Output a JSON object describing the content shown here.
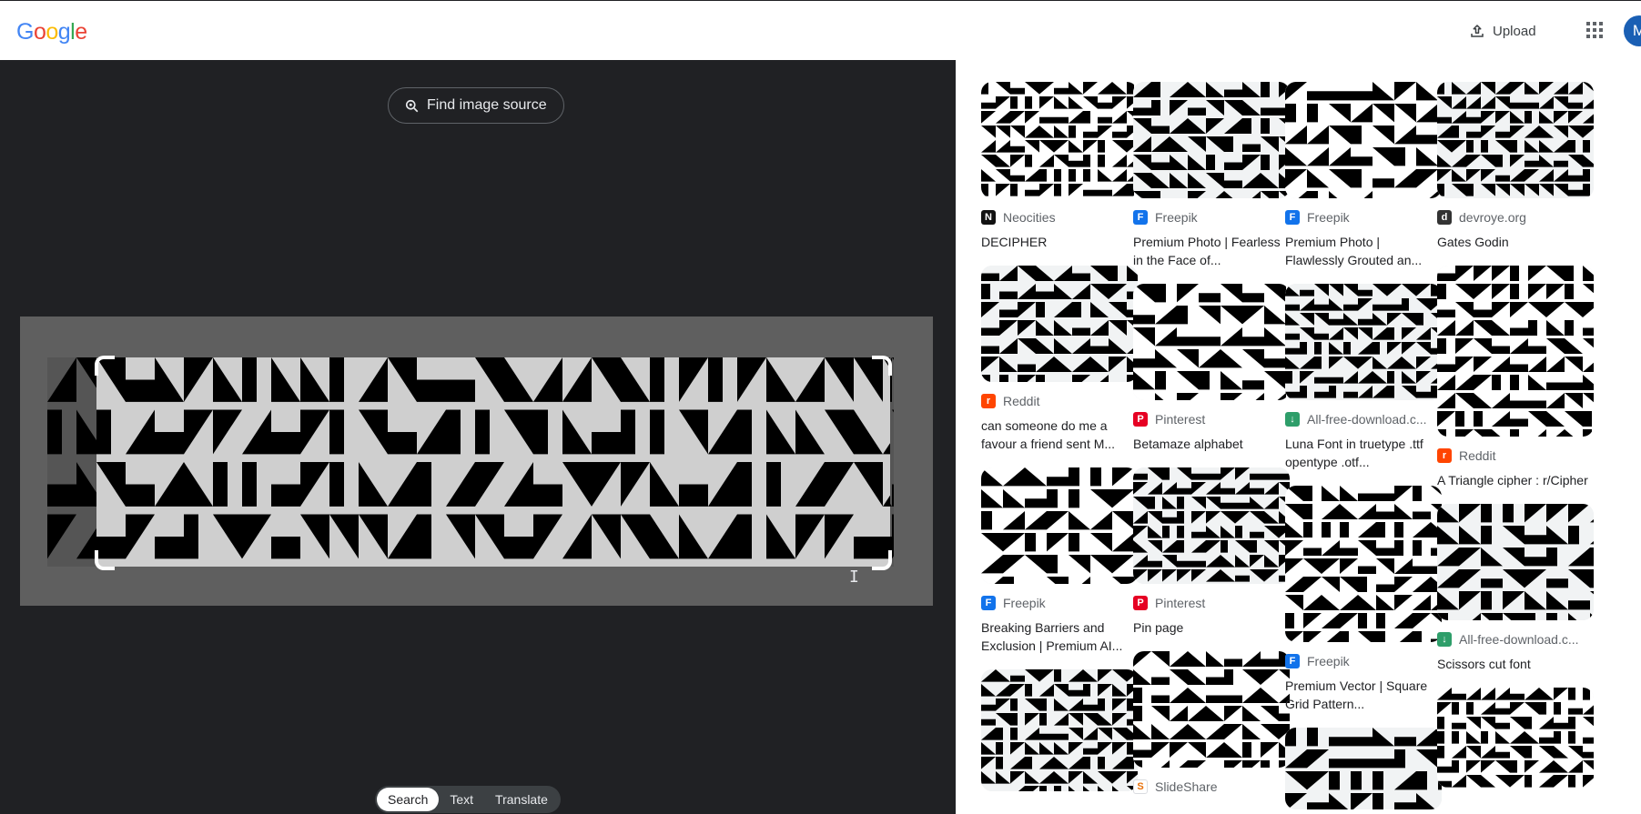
{
  "header": {
    "logo_letters": [
      {
        "ch": "G",
        "color": "#4285F4"
      },
      {
        "ch": "o",
        "color": "#EA4335"
      },
      {
        "ch": "o",
        "color": "#FBBC05"
      },
      {
        "ch": "g",
        "color": "#4285F4"
      },
      {
        "ch": "l",
        "color": "#34A853"
      },
      {
        "ch": "e",
        "color": "#EA4335"
      }
    ],
    "upload_label": "Upload",
    "avatar_initial": "M"
  },
  "lens": {
    "find_source_label": "Find image source",
    "tabs": [
      {
        "label": "Search",
        "active": true
      },
      {
        "label": "Text",
        "active": false
      },
      {
        "label": "Translate",
        "active": false
      }
    ]
  },
  "results": {
    "columns": [
      [
        {
          "source": "Neocities",
          "favicon": "N",
          "fav_color": "#111111",
          "title": "DECIPHER",
          "thumb_h": 128
        },
        {
          "source": "Reddit",
          "favicon": "r",
          "fav_color": "#FF4500",
          "title": "can someone do me a favour a friend sent M...",
          "thumb_h": 128
        },
        {
          "source": "Freepik",
          "favicon": "F",
          "fav_color": "#1273EB",
          "title": "Breaking Barriers and Exclusion | Premium AI...",
          "thumb_h": 128
        },
        {
          "source": "",
          "favicon": "",
          "fav_color": "#ffffff",
          "title": "",
          "thumb_h": 134
        }
      ],
      [
        {
          "source": "Freepik",
          "favicon": "F",
          "fav_color": "#1273EB",
          "title": "Premium Photo | Fearless in the Face of...",
          "thumb_h": 128
        },
        {
          "source": "Pinterest",
          "favicon": "P",
          "fav_color": "#E60023",
          "title": "Betamaze alphabet",
          "thumb_h": 128
        },
        {
          "source": "Pinterest",
          "favicon": "P",
          "fav_color": "#E60023",
          "title": "Pin page",
          "thumb_h": 128
        },
        {
          "source": "SlideShare",
          "favicon": "S",
          "fav_color": "#ffffff",
          "title": "",
          "thumb_h": 128
        }
      ],
      [
        {
          "source": "Freepik",
          "favicon": "F",
          "fav_color": "#1273EB",
          "title": "Premium Photo | Flawlessly Grouted an...",
          "thumb_h": 128
        },
        {
          "source": "All-free-download.c...",
          "favicon": "↓",
          "fav_color": "#2E9E6A",
          "title": "Luna Font in truetype .ttf opentype .otf...",
          "thumb_h": 128
        },
        {
          "source": "Freepik",
          "favicon": "F",
          "fav_color": "#1273EB",
          "title": "Premium Vector | Square Grid Pattern...",
          "thumb_h": 172
        },
        {
          "source": "",
          "favicon": "",
          "fav_color": "#ffffff",
          "title": "",
          "thumb_h": 90
        }
      ],
      [
        {
          "source": "devroye.org",
          "favicon": "d",
          "fav_color": "#333333",
          "title": "Gates Godin",
          "thumb_h": 128
        },
        {
          "source": "Reddit",
          "favicon": "r",
          "fav_color": "#FF4500",
          "title": "A Triangle cipher : r/Cipher",
          "thumb_h": 188
        },
        {
          "source": "All-free-download.c...",
          "favicon": "↓",
          "fav_color": "#2E9E6A",
          "title": "Scissors cut font",
          "thumb_h": 128
        },
        {
          "source": "",
          "favicon": "",
          "fav_color": "#ffffff",
          "title": "",
          "thumb_h": 110
        }
      ]
    ]
  }
}
